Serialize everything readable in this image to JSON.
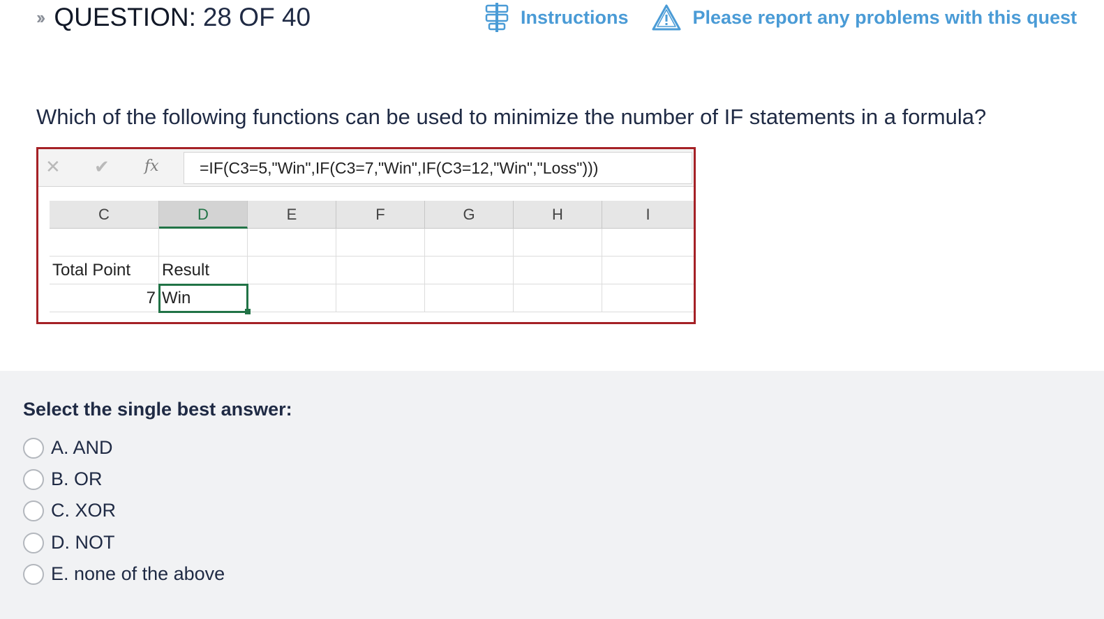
{
  "header": {
    "question_label": "QUESTION:",
    "question_counter": "28 OF 40",
    "instructions_label": "Instructions",
    "report_label": "Please report any problems with this quest"
  },
  "question": {
    "text": "Which of the following functions can be used to minimize the number of IF statements in a formula?"
  },
  "spreadsheet": {
    "formula": "=IF(C3=5,\"Win\",IF(C3=7,\"Win\",IF(C3=12,\"Win\",\"Loss\")))",
    "fx_symbol": "fx",
    "columns": [
      "C",
      "D",
      "E",
      "F",
      "G",
      "H",
      "I"
    ],
    "selected_column": "D",
    "cells": {
      "c2": "Total Point",
      "d2": "Result",
      "c3": "7",
      "d3": "Win"
    }
  },
  "answers": {
    "prompt": "Select the single best answer:",
    "options": [
      {
        "label": "A. AND"
      },
      {
        "label": "B. OR"
      },
      {
        "label": "C. XOR"
      },
      {
        "label": "D. NOT"
      },
      {
        "label": "E. none of the above"
      }
    ]
  },
  "colors": {
    "link": "#4a9bd6",
    "sheet_border": "#a52126",
    "excel_green": "#217346"
  }
}
